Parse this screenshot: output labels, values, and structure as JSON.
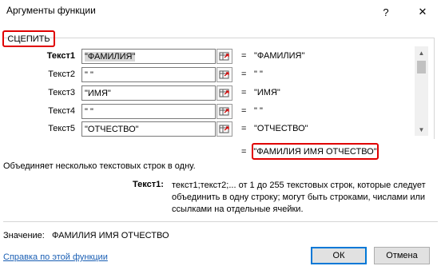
{
  "window": {
    "title": "Аргументы функции",
    "help_glyph": "?",
    "close_glyph": "✕"
  },
  "function_name": "СЦЕПИТЬ",
  "arguments": [
    {
      "label": "Текст1",
      "input": "\"ФАМИЛИЯ\"",
      "value": "\"ФАМИЛИЯ\"",
      "bold": true
    },
    {
      "label": "Текст2",
      "input": "\" \"",
      "value": "\" \""
    },
    {
      "label": "Текст3",
      "input": "\"ИМЯ\"",
      "value": "\"ИМЯ\""
    },
    {
      "label": "Текст4",
      "input": "\" \"",
      "value": "\" \""
    },
    {
      "label": "Текст5",
      "input": "\"ОТЧЕСТВО\"",
      "value": "\"ОТЧЕСТВО\""
    }
  ],
  "equals_sign": "=",
  "result": "\"ФАМИЛИЯ ИМЯ ОТЧЕСТВО\"",
  "description": "Объединяет несколько текстовых строк в одну.",
  "arg_help_label": "Текст1:",
  "arg_help_text": "текст1;текст2;... от 1 до 255 текстовых строк, которые следует объединить в одну строку; могут быть строками, числами или ссылками на отдельные ячейки.",
  "value_line": "Значение:   ФАМИЛИЯ ИМЯ ОТЧЕСТВО",
  "help_link": "Справка по этой функции",
  "buttons": {
    "ok": "ОК",
    "cancel": "Отмена"
  },
  "colors": {
    "highlight": "#e00000",
    "link": "#1a5fb4",
    "ok_border": "#0078d7"
  },
  "icons": {
    "ref_button": "collapse-dialog-icon",
    "scroll_up": "chevron-up-icon",
    "scroll_down": "chevron-down-icon"
  }
}
